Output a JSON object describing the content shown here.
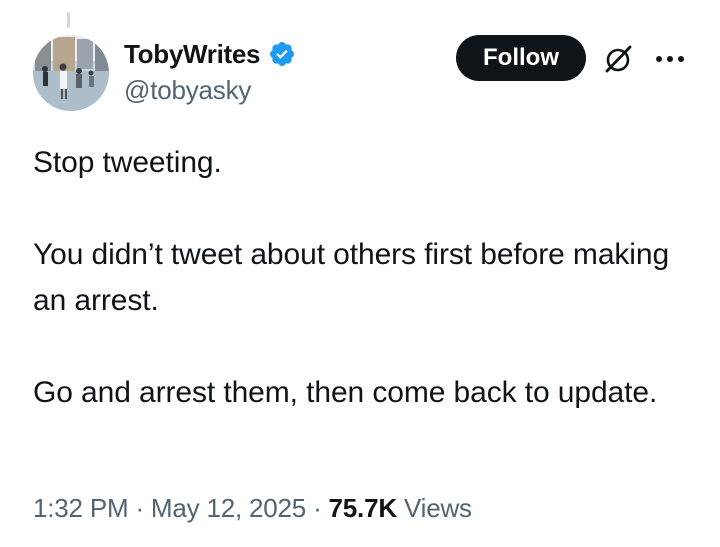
{
  "author": {
    "display_name": "TobyWrites",
    "handle": "@tobyasky",
    "verified": true,
    "verified_color": "#1d9bf0"
  },
  "actions": {
    "follow_label": "Follow",
    "grok_icon": "grok-icon",
    "more_icon": "more-dots-icon"
  },
  "tweet": {
    "paragraphs": [
      "Stop tweeting.",
      "You didn’t tweet about others first before making an arrest.",
      "Go and arrest them, then come back to update."
    ]
  },
  "meta": {
    "time": "1:32 PM",
    "separator": "·",
    "date": "May 12, 2025",
    "views_count": "75.7K",
    "views_label": "Views"
  },
  "colors": {
    "text": "#0f1419",
    "secondary": "#536471",
    "follow_bg": "#0f1419",
    "follow_text": "#ffffff",
    "thread_line": "#cfd9de"
  }
}
